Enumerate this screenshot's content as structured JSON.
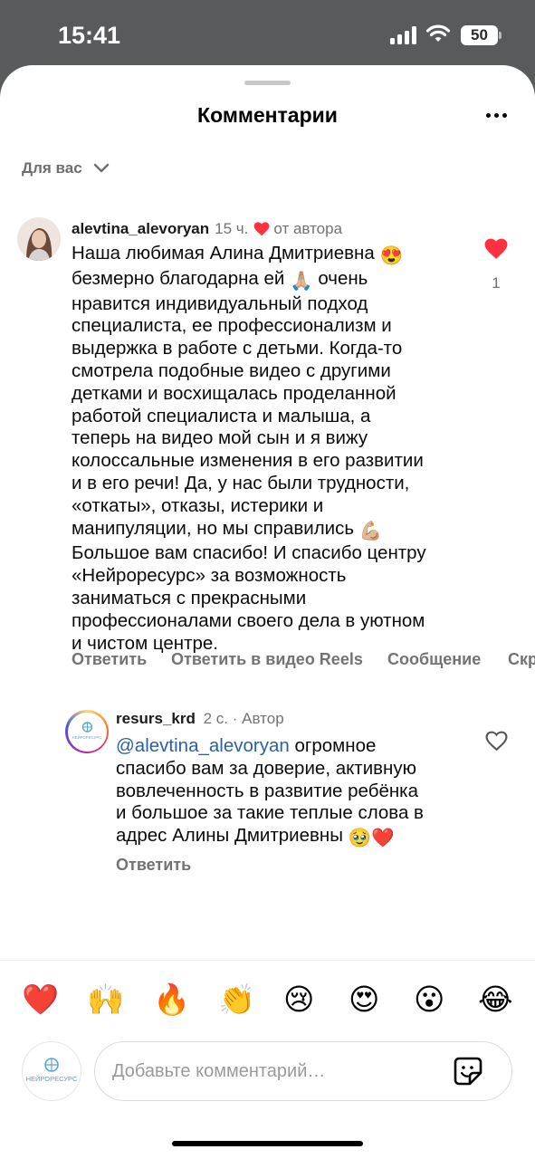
{
  "status_bar": {
    "time": "15:41",
    "battery": "50"
  },
  "sheet": {
    "title": "Комментарии"
  },
  "filter": {
    "label": "Для вас"
  },
  "comment": {
    "username": "alevtina_alevoryan",
    "time": "15 ч.",
    "author_like_label": "от автора",
    "likes": "1",
    "text_lines": [
      "Наша любимая Алина Дмитриевна",
      "безмерно благодарна ей",
      "очень",
      "нравится индивидуальный подход",
      "специалиста, ее профессионализм и",
      "выдержка в работе с детьми. Когда-то",
      "смотрела подобные видео с другими",
      "детками и восхищалась проделанной",
      "работой специалиста и малыша, а",
      "теперь на видео мой сын и я вижу",
      "колоссальные изменения в его развитии",
      "и в его речи! Да, у нас были трудности,",
      "«откаты», отказы, истерики и",
      "манипуляции, но мы справились",
      "Большое вам спасибо! И спасибо центру",
      "«Нейроресурс» за возможность",
      "заниматься с прекрасными",
      "профессионалами своего дела в уютном",
      "и чистом центре."
    ],
    "emojis": {
      "love_eyes": "😍",
      "pray": "🙏🏼",
      "muscle": "💪🏼"
    },
    "actions": [
      "Ответить",
      "Ответить в видео Reels",
      "Сообщение",
      "Скрыть"
    ]
  },
  "reply": {
    "username": "resurs_krd",
    "time": "2 с.",
    "separator": "·",
    "badge": "Автор",
    "mention": "@alevtina_alevoryan",
    "text_lines": [
      "огромное",
      "спасибо вам за доверие, активную",
      "вовлеченность в развитие ребёнка",
      "и большое за такие теплые слова в",
      "адрес Алины Дмитриевны"
    ],
    "emojis": {
      "teary": "🥹",
      "heart": "❤️"
    },
    "reply_action": "Ответить",
    "avatar_text": "НЕЙРОРЕСУРС"
  },
  "reactions": [
    "❤️",
    "🙌",
    "🔥",
    "👏",
    "😢",
    "😍",
    "😮",
    "😂"
  ],
  "composer": {
    "placeholder": "Добавьте комментарий…",
    "avatar_text": "НЕЙРОРЕСУРС"
  },
  "colors": {
    "heart": "#ff3040",
    "mention": "#2a5fa6",
    "muted": "#737373"
  }
}
